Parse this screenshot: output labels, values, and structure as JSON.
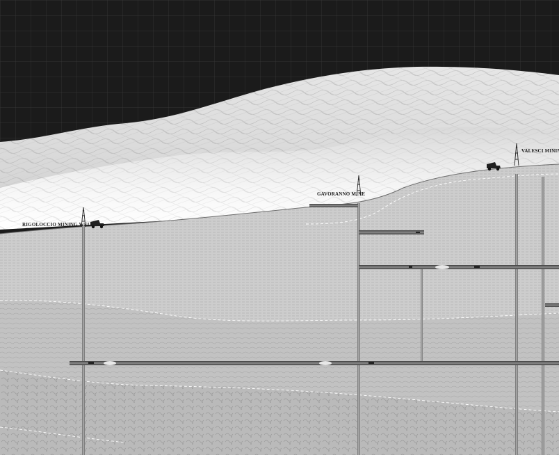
{
  "title": "",
  "colors": {
    "sky": "#1b1b1b",
    "grid": "#3d3d3d",
    "terrain_far": "#ececec",
    "terrain_near": "#fbfbfb",
    "strata_upper": "#cfcfcf",
    "strata_middle": "#c3c3c3",
    "strata_lower": "#bdbdbd",
    "shaft": "#8a8a8a",
    "tunnel": "#5a5a5a",
    "vehicle": "#222222"
  },
  "sites": [
    {
      "label": "RIGOLOCCIO MINING WELL",
      "icon": "mining-tower-icon",
      "vehicle": "mining-truck-icon"
    },
    {
      "label": "GAVORANNO MINE",
      "icon": "mining-tower-icon",
      "vehicle": ""
    },
    {
      "label": "VALESCI MINING W",
      "icon": "mining-tower-icon",
      "vehicle": "mining-truck-icon"
    }
  ],
  "layers": [
    {
      "name": "layer-upper"
    },
    {
      "name": "layer-middle"
    },
    {
      "name": "layer-lower"
    }
  ]
}
